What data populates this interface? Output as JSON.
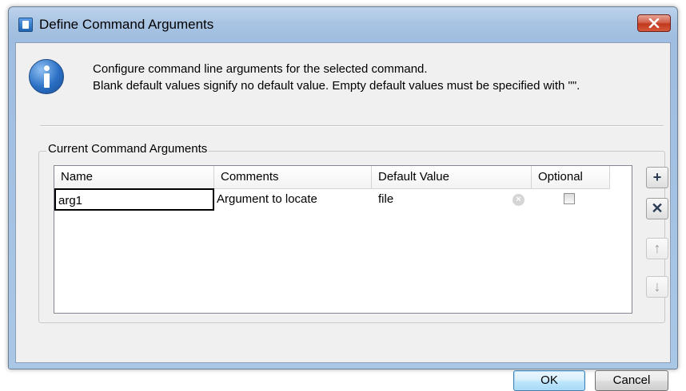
{
  "window": {
    "title": "Define Command Arguments",
    "close_icon": "close-icon"
  },
  "info": {
    "icon": "info-icon",
    "line1": "Configure command line arguments for the selected command.",
    "line2": "Blank default values signify no default value.  Empty default values must be specified with \"\"."
  },
  "group": {
    "label": "Current Command Arguments"
  },
  "table": {
    "columns": [
      "Name",
      "Comments",
      "Default Value",
      "Optional"
    ],
    "rows": [
      {
        "name": "arg1",
        "comments": "Argument to locate",
        "default_value": "file",
        "optional": false
      }
    ]
  },
  "side_buttons": [
    {
      "icon": "plus-icon",
      "glyph": "+",
      "enabled": true
    },
    {
      "icon": "delete-icon",
      "glyph": "✕",
      "enabled": true
    },
    {
      "icon": "move-up-icon",
      "glyph": "↑",
      "enabled": false
    },
    {
      "icon": "move-down-icon",
      "glyph": "↓",
      "enabled": false
    }
  ],
  "buttons": {
    "ok": "OK",
    "cancel": "Cancel"
  },
  "colors": {
    "title_bar": "#a9c4e3",
    "close_button": "#c0391f",
    "ok_button": "#bee6fd"
  }
}
